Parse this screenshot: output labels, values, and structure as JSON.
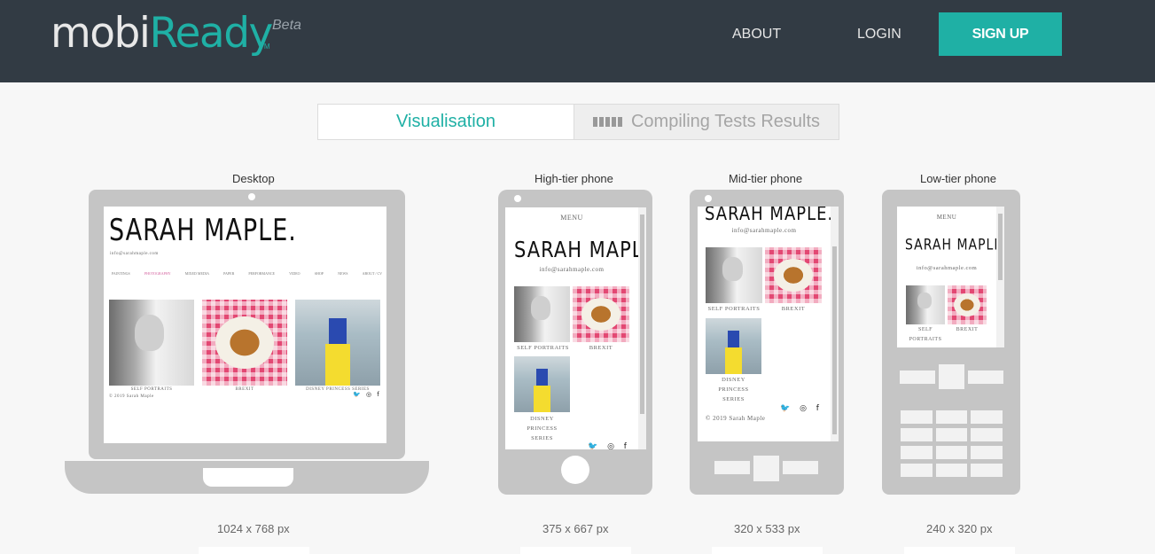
{
  "header": {
    "logo_mobi": "mobi",
    "logo_ready": "Ready",
    "logo_tm": "TM",
    "logo_beta": "Beta",
    "nav_about": "ABOUT",
    "nav_login": "LOGIN",
    "signup": "SIGN UP"
  },
  "tabs": {
    "visualisation": "Visualisation",
    "compiling": "Compiling Tests Results"
  },
  "devices": [
    {
      "label": "Desktop",
      "dims": "1024 x 768 px"
    },
    {
      "label": "High-tier phone",
      "dims": "375 x 667 px"
    },
    {
      "label": "Mid-tier phone",
      "dims": "320 x 533 px"
    },
    {
      "label": "Low-tier phone",
      "dims": "240 x 320 px"
    }
  ],
  "site": {
    "signature": "SARAH MAPLE.",
    "email": "info@sarahmaple.com",
    "menu": "MENU",
    "desktop_nav": [
      "PAINTINGS",
      "PHOTOGRAPHY",
      "MIXED MEDIA",
      "PAPER",
      "PERFORMANCE",
      "VIDEO",
      "SHOP",
      "NEWS",
      "ABOUT / CV"
    ],
    "self_portraits": "SELF PORTRAITS",
    "brexit": "BREXIT",
    "disney": "DISNEY PRINCESS SERIES",
    "disney_l1": "DISNEY",
    "disney_l2": "PRINCESS",
    "disney_l3": "SERIES",
    "self_l1": "SELF",
    "self_l2": "PORTRAITS",
    "copyright": "© 2019 Sarah Maple",
    "social": "🐦 ◎ f"
  }
}
